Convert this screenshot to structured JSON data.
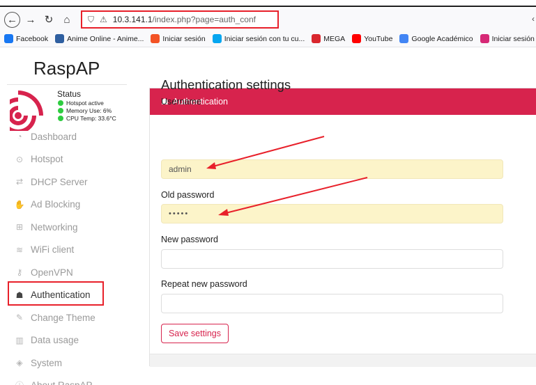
{
  "browser": {
    "url_host": "10.3.141.1",
    "url_path": "/index.php?page=auth_conf",
    "bookmarks": [
      {
        "label": "Facebook",
        "color": "#1877f2"
      },
      {
        "label": "Anime Online - Anime...",
        "color": "#2f5fa0"
      },
      {
        "label": "Iniciar sesión",
        "color": "#f35325"
      },
      {
        "label": "Iniciar sesión con tu cu...",
        "color": "#05a6f0"
      },
      {
        "label": "MEGA",
        "color": "#d9272e"
      },
      {
        "label": "YouTube",
        "color": "#ff0000"
      },
      {
        "label": "Google Académico",
        "color": "#4285f4"
      },
      {
        "label": "Iniciar sesión • Insta",
        "color": "#d62976"
      }
    ]
  },
  "sidebar": {
    "brand": "RaspAP",
    "status": {
      "title": "Status",
      "lines": [
        "Hotspot active",
        "Memory Use: 6%",
        "CPU Temp: 33.6°C"
      ]
    },
    "items": [
      {
        "label": "Dashboard",
        "icon": "tachometer-icon",
        "glyph": "◔"
      },
      {
        "label": "Hotspot",
        "icon": "hotspot-icon",
        "glyph": "⊙"
      },
      {
        "label": "DHCP Server",
        "icon": "exchange-icon",
        "glyph": "⇄"
      },
      {
        "label": "Ad Blocking",
        "icon": "hand-icon",
        "glyph": "✋"
      },
      {
        "label": "Networking",
        "icon": "network-icon",
        "glyph": "⊞"
      },
      {
        "label": "WiFi client",
        "icon": "wifi-icon",
        "glyph": "≋"
      },
      {
        "label": "OpenVPN",
        "icon": "key-icon",
        "glyph": "⚷"
      },
      {
        "label": "Authentication",
        "icon": "user-lock-icon",
        "glyph": "☗"
      },
      {
        "label": "Change Theme",
        "icon": "brush-icon",
        "glyph": "✎"
      },
      {
        "label": "Data usage",
        "icon": "chart-icon",
        "glyph": "▥"
      },
      {
        "label": "System",
        "icon": "cube-icon",
        "glyph": "◈"
      },
      {
        "label": "About RaspAP",
        "icon": "info-icon",
        "glyph": "ⓘ"
      }
    ],
    "active_index": 7
  },
  "main": {
    "card_title": "Authentication",
    "heading": "Authentication settings",
    "username_label": "Username",
    "username_value": "admin",
    "old_password_label": "Old password",
    "old_password_value": "•••••",
    "new_password_label": "New password",
    "new_password_value": "",
    "repeat_password_label": "Repeat new password",
    "repeat_password_value": "",
    "save_label": "Save settings"
  },
  "colors": {
    "accent": "#d7234d",
    "highlight": "#e8202a",
    "status_ok": "#2ecc40",
    "autofill": "#fcf4c9"
  }
}
